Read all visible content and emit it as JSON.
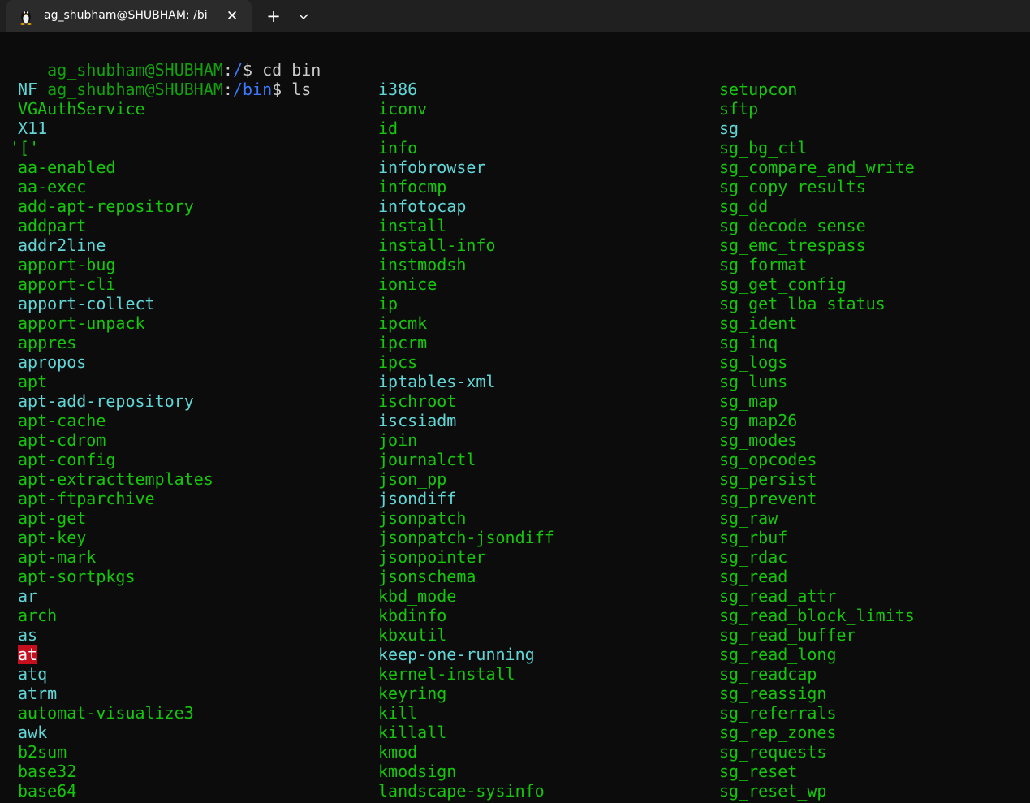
{
  "tab": {
    "title": "ag_shubham@SHUBHAM: /bi",
    "icon": "linux-penguin-icon",
    "close_symbol": "✕",
    "new_tab_symbol": "+"
  },
  "colors": {
    "exec": "#16c60c",
    "link": "#61d6d6",
    "highlight_bg": "#c50f1f",
    "prompt_user": "#13a10e",
    "prompt_path": "#3b78ff"
  },
  "terminal": {
    "lines": [
      {
        "user": "ag_shubham@SHUBHAM",
        "sep": ":",
        "path": "/",
        "tail": "$ cd bin"
      },
      {
        "user": "ag_shubham@SHUBHAM",
        "sep": ":",
        "path": "/bin",
        "tail": "$ ls"
      }
    ],
    "columns": [
      [
        {
          "name": "NF",
          "type": "link"
        },
        {
          "name": "VGAuthService",
          "type": "exec"
        },
        {
          "name": "X11",
          "type": "link"
        },
        {
          "name": "'['",
          "type": "exec",
          "quoted": true
        },
        {
          "name": "aa-enabled",
          "type": "exec"
        },
        {
          "name": "aa-exec",
          "type": "exec"
        },
        {
          "name": "add-apt-repository",
          "type": "exec"
        },
        {
          "name": "addpart",
          "type": "exec"
        },
        {
          "name": "addr2line",
          "type": "link"
        },
        {
          "name": "apport-bug",
          "type": "exec"
        },
        {
          "name": "apport-cli",
          "type": "exec"
        },
        {
          "name": "apport-collect",
          "type": "link"
        },
        {
          "name": "apport-unpack",
          "type": "exec"
        },
        {
          "name": "appres",
          "type": "exec"
        },
        {
          "name": "apropos",
          "type": "link"
        },
        {
          "name": "apt",
          "type": "exec"
        },
        {
          "name": "apt-add-repository",
          "type": "link"
        },
        {
          "name": "apt-cache",
          "type": "exec"
        },
        {
          "name": "apt-cdrom",
          "type": "exec"
        },
        {
          "name": "apt-config",
          "type": "exec"
        },
        {
          "name": "apt-extracttemplates",
          "type": "exec"
        },
        {
          "name": "apt-ftparchive",
          "type": "exec"
        },
        {
          "name": "apt-get",
          "type": "exec"
        },
        {
          "name": "apt-key",
          "type": "exec"
        },
        {
          "name": "apt-mark",
          "type": "exec"
        },
        {
          "name": "apt-sortpkgs",
          "type": "exec"
        },
        {
          "name": "ar",
          "type": "link"
        },
        {
          "name": "arch",
          "type": "exec"
        },
        {
          "name": "as",
          "type": "link"
        },
        {
          "name": "at",
          "type": "highlight"
        },
        {
          "name": "atq",
          "type": "link"
        },
        {
          "name": "atrm",
          "type": "link"
        },
        {
          "name": "automat-visualize3",
          "type": "exec"
        },
        {
          "name": "awk",
          "type": "link"
        },
        {
          "name": "b2sum",
          "type": "exec"
        },
        {
          "name": "base32",
          "type": "exec"
        },
        {
          "name": "base64",
          "type": "exec"
        }
      ],
      [
        {
          "name": "i386",
          "type": "link"
        },
        {
          "name": "iconv",
          "type": "exec"
        },
        {
          "name": "id",
          "type": "exec"
        },
        {
          "name": "info",
          "type": "exec"
        },
        {
          "name": "infobrowser",
          "type": "link"
        },
        {
          "name": "infocmp",
          "type": "exec"
        },
        {
          "name": "infotocap",
          "type": "link"
        },
        {
          "name": "install",
          "type": "exec"
        },
        {
          "name": "install-info",
          "type": "exec"
        },
        {
          "name": "instmodsh",
          "type": "exec"
        },
        {
          "name": "ionice",
          "type": "exec"
        },
        {
          "name": "ip",
          "type": "exec"
        },
        {
          "name": "ipcmk",
          "type": "exec"
        },
        {
          "name": "ipcrm",
          "type": "exec"
        },
        {
          "name": "ipcs",
          "type": "exec"
        },
        {
          "name": "iptables-xml",
          "type": "link"
        },
        {
          "name": "ischroot",
          "type": "exec"
        },
        {
          "name": "iscsiadm",
          "type": "link"
        },
        {
          "name": "join",
          "type": "exec"
        },
        {
          "name": "journalctl",
          "type": "exec"
        },
        {
          "name": "json_pp",
          "type": "exec"
        },
        {
          "name": "jsondiff",
          "type": "link"
        },
        {
          "name": "jsonpatch",
          "type": "exec"
        },
        {
          "name": "jsonpatch-jsondiff",
          "type": "exec"
        },
        {
          "name": "jsonpointer",
          "type": "exec"
        },
        {
          "name": "jsonschema",
          "type": "exec"
        },
        {
          "name": "kbd_mode",
          "type": "exec"
        },
        {
          "name": "kbdinfo",
          "type": "exec"
        },
        {
          "name": "kbxutil",
          "type": "exec"
        },
        {
          "name": "keep-one-running",
          "type": "link"
        },
        {
          "name": "kernel-install",
          "type": "exec"
        },
        {
          "name": "keyring",
          "type": "exec"
        },
        {
          "name": "kill",
          "type": "exec"
        },
        {
          "name": "killall",
          "type": "exec"
        },
        {
          "name": "kmod",
          "type": "exec"
        },
        {
          "name": "kmodsign",
          "type": "exec"
        },
        {
          "name": "landscape-sysinfo",
          "type": "exec"
        }
      ],
      [
        {
          "name": "setupcon",
          "type": "exec"
        },
        {
          "name": "sftp",
          "type": "exec"
        },
        {
          "name": "sg",
          "type": "link"
        },
        {
          "name": "sg_bg_ctl",
          "type": "exec"
        },
        {
          "name": "sg_compare_and_write",
          "type": "exec"
        },
        {
          "name": "sg_copy_results",
          "type": "exec"
        },
        {
          "name": "sg_dd",
          "type": "exec"
        },
        {
          "name": "sg_decode_sense",
          "type": "exec"
        },
        {
          "name": "sg_emc_trespass",
          "type": "exec"
        },
        {
          "name": "sg_format",
          "type": "exec"
        },
        {
          "name": "sg_get_config",
          "type": "exec"
        },
        {
          "name": "sg_get_lba_status",
          "type": "exec"
        },
        {
          "name": "sg_ident",
          "type": "exec"
        },
        {
          "name": "sg_inq",
          "type": "exec"
        },
        {
          "name": "sg_logs",
          "type": "exec"
        },
        {
          "name": "sg_luns",
          "type": "exec"
        },
        {
          "name": "sg_map",
          "type": "exec"
        },
        {
          "name": "sg_map26",
          "type": "exec"
        },
        {
          "name": "sg_modes",
          "type": "exec"
        },
        {
          "name": "sg_opcodes",
          "type": "exec"
        },
        {
          "name": "sg_persist",
          "type": "exec"
        },
        {
          "name": "sg_prevent",
          "type": "exec"
        },
        {
          "name": "sg_raw",
          "type": "exec"
        },
        {
          "name": "sg_rbuf",
          "type": "exec"
        },
        {
          "name": "sg_rdac",
          "type": "exec"
        },
        {
          "name": "sg_read",
          "type": "exec"
        },
        {
          "name": "sg_read_attr",
          "type": "exec"
        },
        {
          "name": "sg_read_block_limits",
          "type": "exec"
        },
        {
          "name": "sg_read_buffer",
          "type": "exec"
        },
        {
          "name": "sg_read_long",
          "type": "exec"
        },
        {
          "name": "sg_readcap",
          "type": "exec"
        },
        {
          "name": "sg_reassign",
          "type": "exec"
        },
        {
          "name": "sg_referrals",
          "type": "exec"
        },
        {
          "name": "sg_rep_zones",
          "type": "exec"
        },
        {
          "name": "sg_requests",
          "type": "exec"
        },
        {
          "name": "sg_reset",
          "type": "exec"
        },
        {
          "name": "sg_reset_wp",
          "type": "exec"
        }
      ]
    ]
  }
}
